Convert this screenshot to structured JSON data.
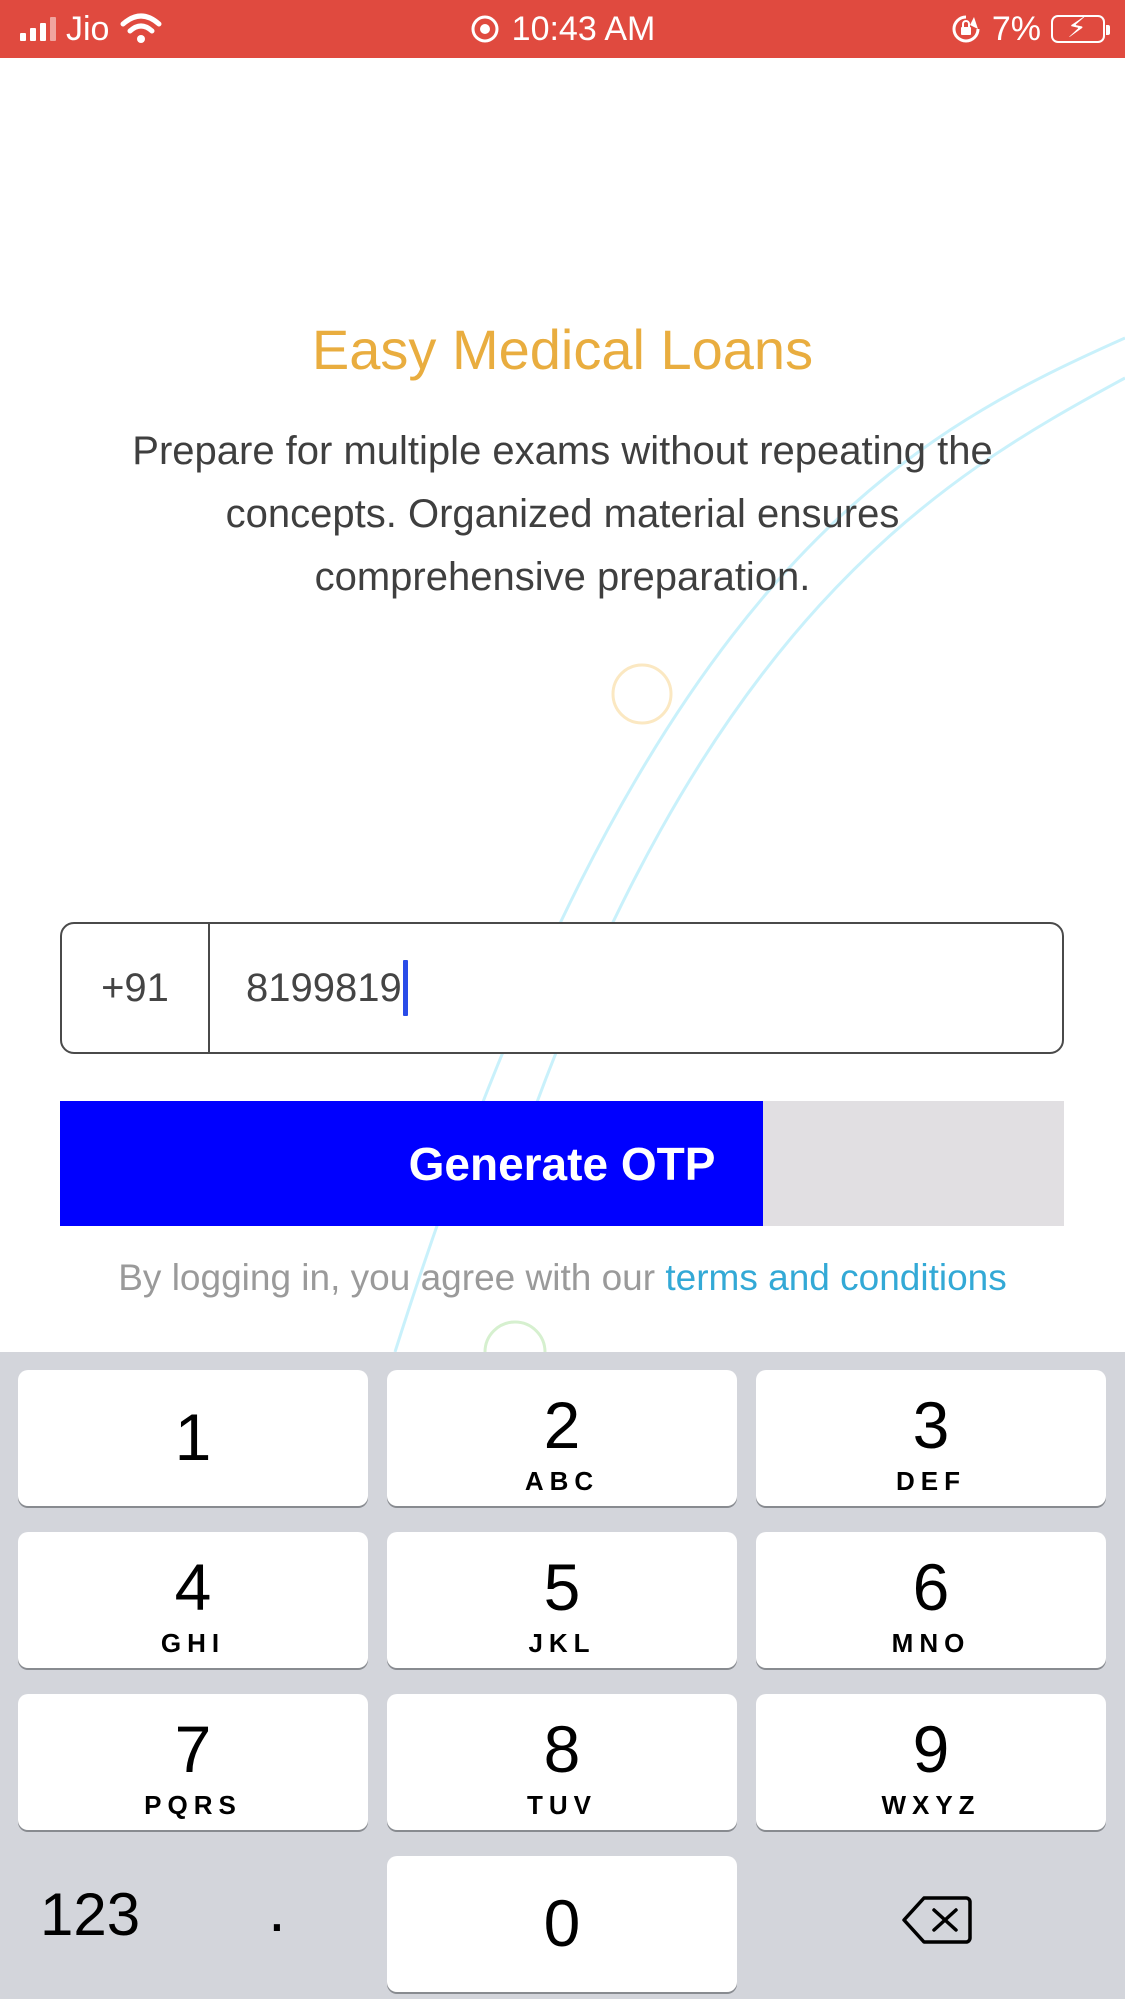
{
  "status_bar": {
    "carrier": "Jio",
    "time": "10:43 AM",
    "battery_percent": "7%",
    "icons": [
      "signal-icon",
      "wifi-icon",
      "screen-record-icon",
      "rotation-lock-icon",
      "battery-charging-icon"
    ],
    "background_color": "#e04a3f"
  },
  "hero": {
    "title": "Easy Medical Loans",
    "description": "Prepare for multiple exams without repeating the concepts. Organized material ensures comprehensive preparation.",
    "title_color": "#e9ad3f"
  },
  "login_form": {
    "country_code": "+91",
    "phone_value": "8199819",
    "generate_button": {
      "label": "Generate OTP",
      "progress_fraction": 0.7,
      "fill_color": "#0000ff"
    },
    "terms_prefix": "By logging in, you agree with our ",
    "terms_link": "terms and conditions",
    "link_color": "#33a9d6"
  },
  "keyboard": {
    "keys": [
      {
        "digit": "1",
        "letters": ""
      },
      {
        "digit": "2",
        "letters": "ABC"
      },
      {
        "digit": "3",
        "letters": "DEF"
      },
      {
        "digit": "4",
        "letters": "GHI"
      },
      {
        "digit": "5",
        "letters": "JKL"
      },
      {
        "digit": "6",
        "letters": "MNO"
      },
      {
        "digit": "7",
        "letters": "PQRS"
      },
      {
        "digit": "8",
        "letters": "TUV"
      },
      {
        "digit": "9",
        "letters": "WXYZ"
      }
    ],
    "mode_key": "123",
    "decimal_key": ".",
    "zero_key": "0",
    "delete_icon": "backspace-icon"
  }
}
